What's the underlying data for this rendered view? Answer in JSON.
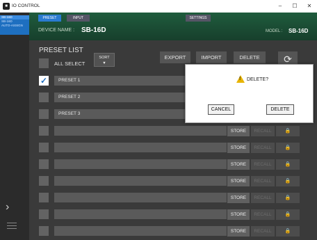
{
  "window": {
    "title": "IO CONTROL",
    "minimize": "–",
    "maximize": "☐",
    "close": "✕"
  },
  "devices": [
    "SB-16D",
    "SB-16D",
    "AUTO-ASSIGN"
  ],
  "tabs": {
    "preset": "PRESET",
    "input": "INPUT",
    "settings": "SETTINGS"
  },
  "header": {
    "device_label": "DEVICE NAME :",
    "device_name": "SB-16D",
    "model_label": "MODEL :",
    "model_name": "SB-16D"
  },
  "main": {
    "title": "PRESET LIST",
    "all_select": "ALL SELECT",
    "sort": "SORT",
    "sort_arrow": "▼",
    "export": "EXPORT",
    "import": "IMPORT",
    "delete": "DELETE",
    "refresh": "⟳"
  },
  "rows": [
    {
      "name": "PRESET 1",
      "checked": true
    },
    {
      "name": "PRESET 2",
      "checked": false
    },
    {
      "name": "PRESET 3",
      "checked": false
    },
    {
      "name": "",
      "checked": false
    },
    {
      "name": "",
      "checked": false
    },
    {
      "name": "",
      "checked": false
    },
    {
      "name": "",
      "checked": false
    },
    {
      "name": "",
      "checked": false
    },
    {
      "name": "",
      "checked": false
    },
    {
      "name": "",
      "checked": false
    }
  ],
  "row_labels": {
    "store": "STORE",
    "recall": "RECALL",
    "lock": "🔒",
    "check": "✓"
  },
  "dialog": {
    "message": "DELETE?",
    "cancel": "CANCEL",
    "confirm": "DELETE",
    "warn_mark": "!"
  },
  "colors": {
    "accent": "#1e6fc0",
    "header": "#1f5c3d",
    "warning": "#e8b400"
  }
}
